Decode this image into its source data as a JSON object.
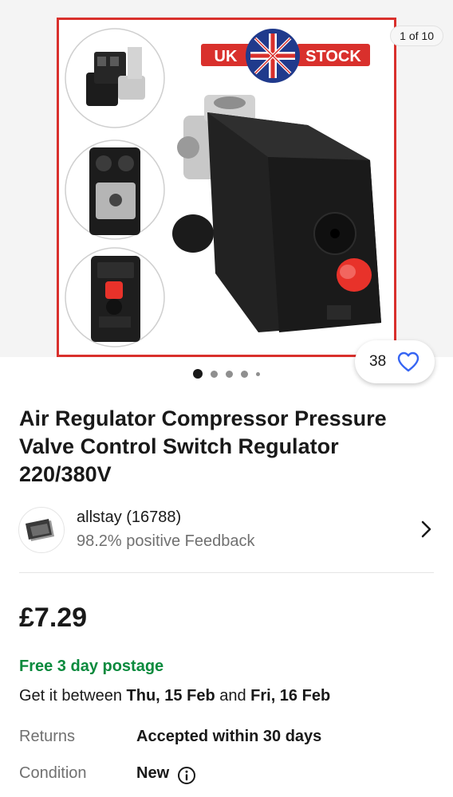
{
  "gallery": {
    "counter": "1 of 10",
    "badge": {
      "left_text": "UK",
      "right_text": "STOCK"
    },
    "dots": 5,
    "active_dot": 0
  },
  "watch": {
    "count": "38"
  },
  "listing": {
    "title": "Air Regulator Compressor Pressure Valve Control Switch Regulator 220/380V"
  },
  "seller": {
    "name": "allstay (16788)",
    "feedback": "98.2% positive Feedback"
  },
  "price": "£7.29",
  "shipping": {
    "postage": "Free 3 day postage",
    "delivery_prefix": "Get it between ",
    "date_from": "Thu, 15 Feb",
    "delivery_and": " and ",
    "date_to": "Fri, 16 Feb"
  },
  "details": {
    "returns_label": "Returns",
    "returns_value": "Accepted within 30 days",
    "condition_label": "Condition",
    "condition_value": "New"
  },
  "colors": {
    "postage_green": "#0a8a3d",
    "watch_blue": "#3665f3",
    "frame_red": "#d9302c",
    "knob_red": "#e8322a"
  }
}
